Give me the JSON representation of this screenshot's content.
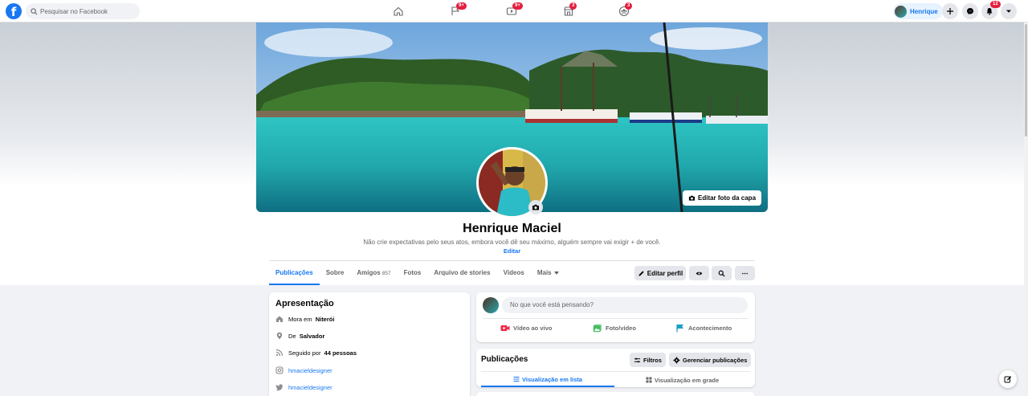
{
  "search": {
    "placeholder": "Pesquisar no Facebook"
  },
  "nav": {
    "badges": {
      "pages": "9+",
      "watch": "9+",
      "marketplace": "3",
      "groups": "3",
      "notifications": "12"
    },
    "user_name": "Henrique"
  },
  "profile": {
    "name": "Henrique Maciel",
    "bio": "Não crie expectativas pelo seus atos, embora você dê seu máximo, alguém sempre vai exigir + de você.",
    "bio_edit": "Editar",
    "edit_cover": "Editar foto da capa"
  },
  "tabs": [
    {
      "label": "Publicações",
      "active": true
    },
    {
      "label": "Sobre"
    },
    {
      "label": "Amigos",
      "count": "857"
    },
    {
      "label": "Fotos"
    },
    {
      "label": "Arquivo de stories"
    },
    {
      "label": "Vídeos"
    },
    {
      "label": "Mais"
    }
  ],
  "actions": {
    "edit_profile": "Editar perfil"
  },
  "intro": {
    "title": "Apresentação",
    "lives_prefix": "Mora em",
    "lives_city": "Niterói",
    "from_prefix": "De",
    "from_city": "Salvador",
    "followed_prefix": "Seguido por",
    "followed_count": "44 pessoas",
    "instagram": "hmacieldesigner",
    "twitter": "hmacieldesigner"
  },
  "composer": {
    "placeholder": "No que você está pensando?",
    "live": "Vídeo ao vivo",
    "photo": "Foto/vídeo",
    "event": "Acontecimento"
  },
  "posts": {
    "title": "Publicações",
    "filters": "Filtros",
    "manage": "Gerenciar publicações",
    "list_view": "Visualização em lista",
    "grid_view": "Visualização em grade"
  },
  "colors": {
    "brand": "#1877f2",
    "badge": "#e41e3f",
    "live": "#f02849",
    "photo": "#45bd62",
    "event": "#1b9ec7"
  }
}
